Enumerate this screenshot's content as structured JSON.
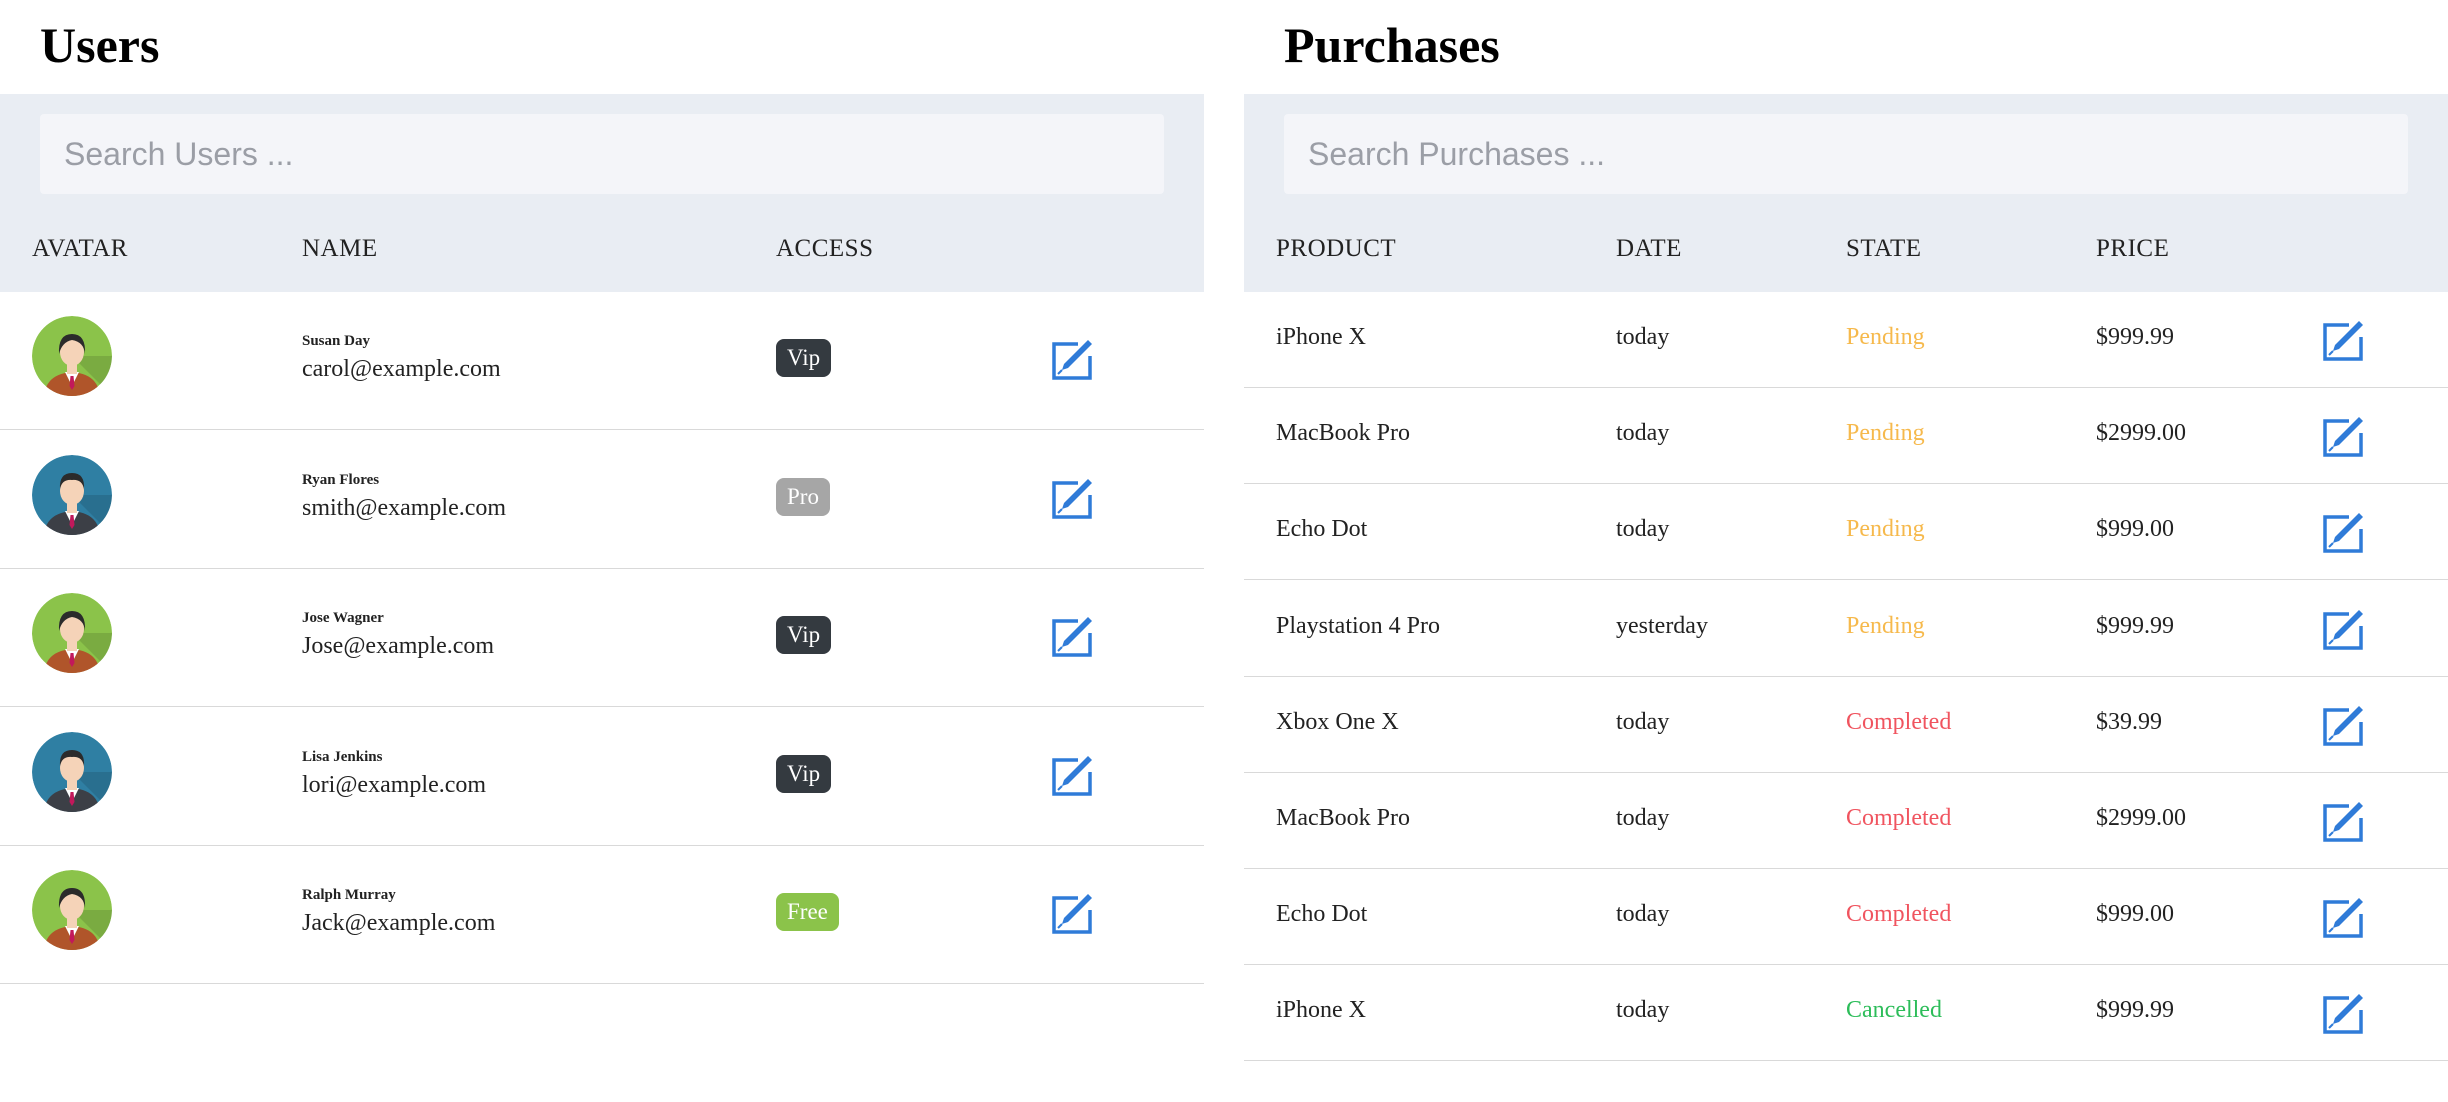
{
  "users": {
    "title": "Users",
    "search_placeholder": "Search Users ...",
    "columns": [
      "AVATAR",
      "NAME",
      "ACCESS"
    ],
    "rows": [
      {
        "name": "Susan Day",
        "email": "carol@example.com",
        "access": "Vip",
        "access_color": "#343a40",
        "avatar": "female-avatar-icon",
        "avatar_bg": "#8bc34a"
      },
      {
        "name": "Ryan Flores",
        "email": "smith@example.com",
        "access": "Pro",
        "access_color": "#a6a6a6",
        "avatar": "male-avatar-icon",
        "avatar_bg": "#2f7fa3"
      },
      {
        "name": "Jose Wagner",
        "email": "Jose@example.com",
        "access": "Vip",
        "access_color": "#343a40",
        "avatar": "female-avatar-icon",
        "avatar_bg": "#8bc34a"
      },
      {
        "name": "Lisa Jenkins",
        "email": "lori@example.com",
        "access": "Vip",
        "access_color": "#343a40",
        "avatar": "male-avatar-icon",
        "avatar_bg": "#2f7fa3"
      },
      {
        "name": "Ralph Murray",
        "email": "Jack@example.com",
        "access": "Free",
        "access_color": "#8bc34a",
        "avatar": "female-avatar-icon",
        "avatar_bg": "#8bc34a"
      }
    ]
  },
  "purchases": {
    "title": "Purchases",
    "search_placeholder": "Search Purchases ...",
    "columns": [
      "PRODUCT",
      "DATE",
      "STATE",
      "PRICE"
    ],
    "rows": [
      {
        "product": "iPhone X",
        "date": "today",
        "state": "Pending",
        "state_color": "#f6b94c",
        "price": "$999.99"
      },
      {
        "product": "MacBook Pro",
        "date": "today",
        "state": "Pending",
        "state_color": "#f6b94c",
        "price": "$2999.00"
      },
      {
        "product": "Echo Dot",
        "date": "today",
        "state": "Pending",
        "state_color": "#f6b94c",
        "price": "$999.00"
      },
      {
        "product": "Playstation 4 Pro",
        "date": "yesterday",
        "state": "Pending",
        "state_color": "#f6b94c",
        "price": "$999.99"
      },
      {
        "product": "Xbox One X",
        "date": "today",
        "state": "Completed",
        "state_color": "#f0545f",
        "price": "$39.99"
      },
      {
        "product": "MacBook Pro",
        "date": "today",
        "state": "Completed",
        "state_color": "#f0545f",
        "price": "$2999.00"
      },
      {
        "product": "Echo Dot",
        "date": "today",
        "state": "Completed",
        "state_color": "#f0545f",
        "price": "$999.00"
      },
      {
        "product": "iPhone X",
        "date": "today",
        "state": "Cancelled",
        "state_color": "#2dbd5a",
        "price": "$999.99"
      }
    ]
  },
  "colors": {
    "header_bg": "#e9edf3",
    "search_bg": "#f4f5f9",
    "edit_icon": "#2f7bd8"
  },
  "icons": {
    "edit": "edit-pencil-icon"
  }
}
